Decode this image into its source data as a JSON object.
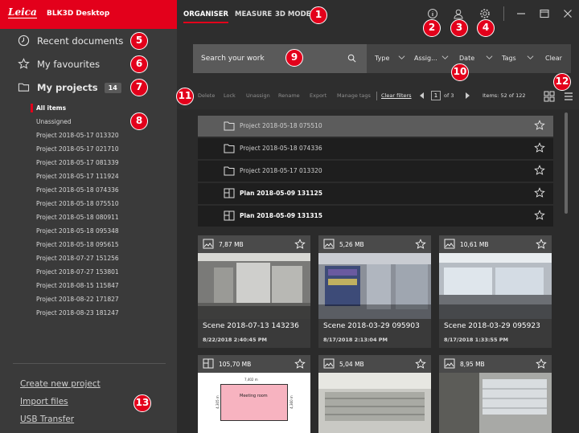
{
  "brand": {
    "logo": "Leica",
    "app_name": "BLK3D Desktop"
  },
  "colors": {
    "accent": "#e3001b",
    "sidebar": "#3a3a3a",
    "background": "#2b2b2b"
  },
  "sidebar": {
    "recent": "Recent documents",
    "favourites": "My favourites",
    "projects": "My projects",
    "projects_count": "14",
    "project_items": [
      "All items",
      "Unassigned",
      "Project 2018-05-17 013320",
      "Project 2018-05-17 021710",
      "Project 2018-05-17 081339",
      "Project 2018-05-17 111924",
      "Project 2018-05-18 074336",
      "Project 2018-05-18 075510",
      "Project 2018-05-18 080911",
      "Project 2018-05-18 095348",
      "Project 2018-05-18 095615",
      "Project 2018-07-27 151256",
      "Project 2018-07-27 153801",
      "Project 2018-08-15 115847",
      "Project 2018-08-22 171827",
      "Project 2018-08-23 181247"
    ],
    "actions": {
      "create": "Create new project",
      "import": "Import files",
      "usb": "USB Transfer"
    }
  },
  "topbar": {
    "tabs": [
      "ORGANISER",
      "MEASURE",
      "3D MODEL"
    ],
    "active_tab": "ORGANISER",
    "icons": [
      "info-icon",
      "user-icon",
      "settings-icon",
      "minimize-icon",
      "maximize-icon",
      "close-icon"
    ]
  },
  "search": {
    "placeholder": "Search your work",
    "filters": [
      "Type",
      "Assig...",
      "Date",
      "Tags"
    ],
    "clear": "Clear"
  },
  "toolbar": {
    "actions": [
      "Delete",
      "Lock",
      "Unassign",
      "Rename",
      "Export",
      "Manage tags"
    ],
    "clear_filters": "Clear filters",
    "page": "1",
    "page_of": "of 3",
    "items": "Items: 52 of 122"
  },
  "list_rows": [
    {
      "name": "Project 2018-05-18 075510",
      "type": "folder",
      "selected": true
    },
    {
      "name": "Project 2018-05-18 074336",
      "type": "folder",
      "selected": false
    },
    {
      "name": "Project 2018-05-17 013320",
      "type": "folder",
      "selected": false
    },
    {
      "name": "Plan 2018-05-09 131125",
      "type": "plan",
      "selected": false
    },
    {
      "name": "Plan 2018-05-09 131315",
      "type": "plan",
      "selected": false
    }
  ],
  "cards": [
    {
      "size": "7,87 MB",
      "name": "Scene 2018-07-13 143236",
      "date": "8/22/2018 2:40:45 PM",
      "kind": "image"
    },
    {
      "size": "5,26 MB",
      "name": "Scene 2018-03-29 095903",
      "date": "8/17/2018 2:13:04 PM",
      "kind": "image"
    },
    {
      "size": "10,61 MB",
      "name": "Scene 2018-03-29 095923",
      "date": "8/17/2018 1:33:55 PM",
      "kind": "image"
    },
    {
      "size": "105,70 MB",
      "name": "",
      "date": "",
      "kind": "plan",
      "plan_label": "Meeting room",
      "dim_top": "7,402 m",
      "dim_left": "4,305 m",
      "dim_right": "4,360 m"
    },
    {
      "size": "5,04 MB",
      "name": "",
      "date": "",
      "kind": "image"
    },
    {
      "size": "8,95 MB",
      "name": "",
      "date": "",
      "kind": "image"
    }
  ],
  "callouts": [
    "1",
    "2",
    "3",
    "4",
    "5",
    "6",
    "7",
    "8",
    "9",
    "10",
    "11",
    "12",
    "13"
  ]
}
